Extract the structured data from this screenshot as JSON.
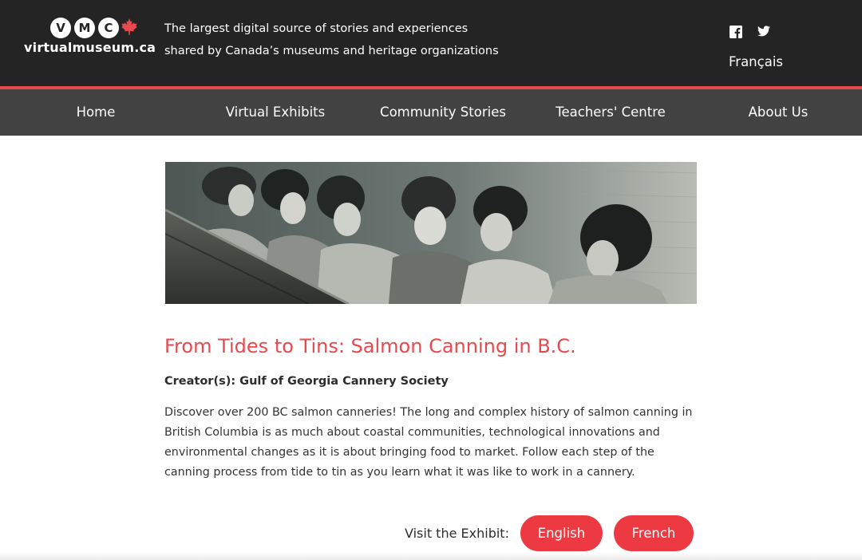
{
  "header": {
    "logo_letters": [
      "V",
      "M",
      "C"
    ],
    "logo_text": "virtualmuseum.ca",
    "tagline_line1": "The largest digital source of stories and experiences",
    "tagline_line2": "shared by Canada’s museums and heritage organizations",
    "social_icons": [
      "facebook-icon",
      "twitter-icon"
    ],
    "language_link": "Français"
  },
  "nav": {
    "items": [
      {
        "label": "Home"
      },
      {
        "label": "Virtual Exhibits"
      },
      {
        "label": "Community Stories"
      },
      {
        "label": "Teachers' Centre"
      },
      {
        "label": "About Us"
      }
    ]
  },
  "exhibit": {
    "title": "From Tides to Tins: Salmon Canning in B.C.",
    "creator": "Creator(s): Gulf of Georgia Cannery Society",
    "description": "Discover over 200 BC salmon canneries! The long and complex history of salmon canning in British Columbia is as much about coastal communities, technological innovations and environmental changes as it is about bringing food to market. Follow each step of the canning process from tide to tin as you learn what it was like to work in a cannery.",
    "visit_label": "Visit the Exhibit:",
    "buttons": {
      "english": "English",
      "french": "French"
    }
  },
  "colors": {
    "header_bg": "#242424",
    "nav_bg": "#424242",
    "accent_red": "#e84a4f",
    "button_red": "#ed3a42"
  }
}
